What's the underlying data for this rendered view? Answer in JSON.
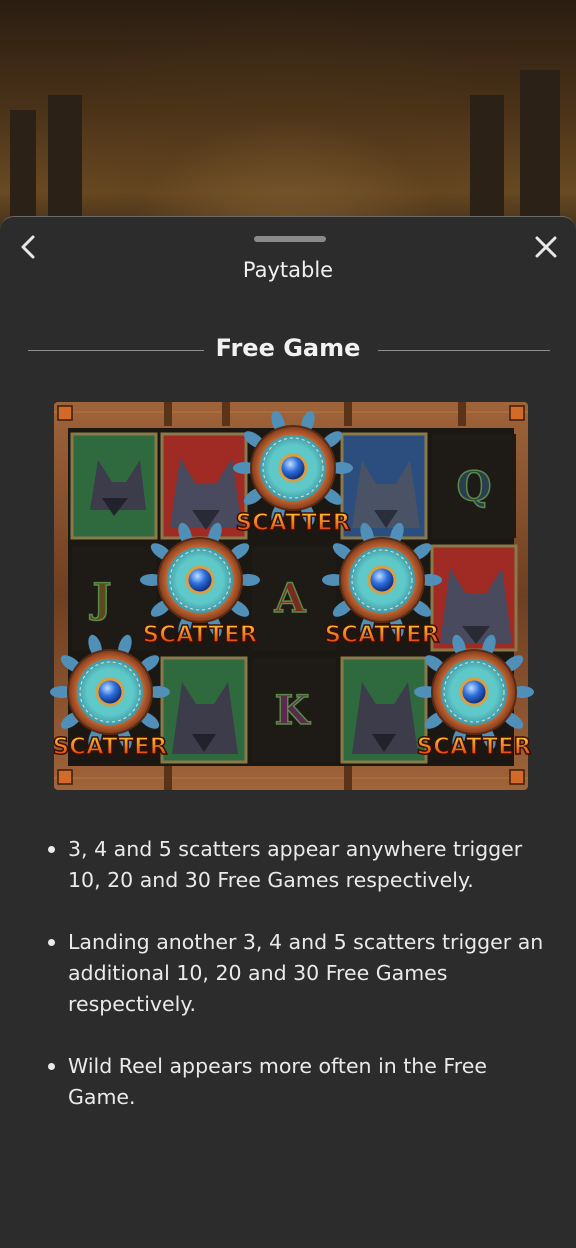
{
  "header": {
    "title": "Paytable",
    "back_icon": "chevron-left-icon",
    "close_icon": "close-icon"
  },
  "section": {
    "title": "Free Game"
  },
  "board": {
    "scatter_label": "SCATTER",
    "letter_symbols": [
      "Q",
      "J",
      "A",
      "K"
    ]
  },
  "rules": [
    "3, 4 and 5 scatters appear anywhere trigger 10, 20 and 30 Free Games respectively.",
    "Landing another 3, 4 and 5 scatters trigger an additional 10, 20 and 30 Free Games respectively.",
    "Wild Reel appears more often in the Free Game."
  ],
  "colors": {
    "sheet_bg": "#2c2c2c",
    "text": "#eaeaea",
    "frame_wood": "#7a4a28",
    "scatter_text": "#e8421c",
    "gem_blue": "#2f6fe0"
  }
}
